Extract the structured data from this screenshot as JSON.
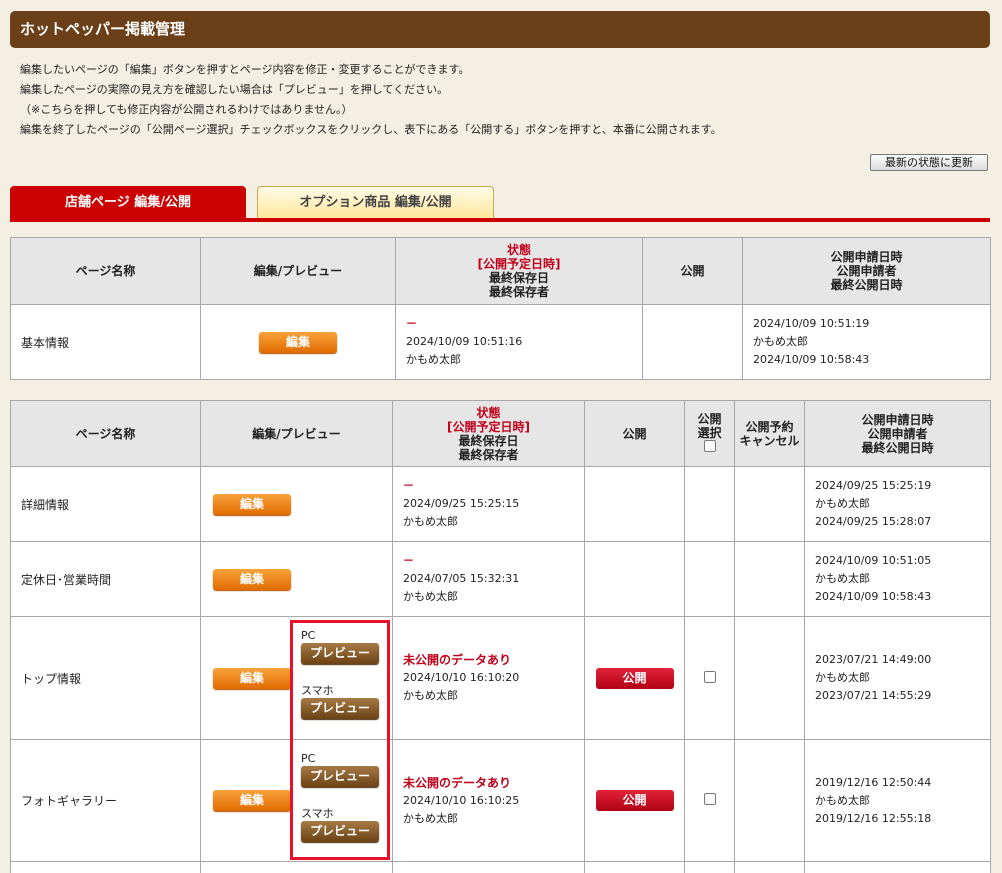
{
  "header": {
    "title": "ホットペッパー掲載管理"
  },
  "intro": {
    "lines": [
      "編集したいページの「編集」ボタンを押すとページ内容を修正・変更することができます。",
      "編集したページの実際の見え方を確認したい場合は「プレビュー」を押してください。",
      "（※こちらを押しても修正内容が公開されるわけではありません。）",
      "編集を終了したページの「公開ページ選択」チェックボックスをクリックし、表下にある「公開する」ボタンを押すと、本番に公開されます。"
    ]
  },
  "refresh_label": "最新の状態に更新",
  "tabs": [
    {
      "label": "店舗ページ 編集/公開",
      "active": true
    },
    {
      "label": "オプション商品 編集/公開",
      "active": false
    }
  ],
  "table1": {
    "headers": {
      "page_name": "ページ名称",
      "edit_preview": "編集/プレビュー",
      "status_top1": "状態",
      "status_top2": "[公開予定日時]",
      "status_bottom1": "最終保存日",
      "status_bottom2": "最終保存者",
      "publish": "公開",
      "dates1": "公開申請日時",
      "dates2": "公開申請者",
      "dates3": "最終公開日時"
    },
    "rows": [
      {
        "name": "基本情報",
        "edit": "編集",
        "status": "－",
        "saved": "2024/10/09 10:51:16",
        "saver": "かもめ太郎",
        "req_date": "2024/10/09 10:51:19",
        "requester": "かもめ太郎",
        "pub_date": "2024/10/09 10:58:43"
      }
    ]
  },
  "table2": {
    "headers": {
      "page_name": "ページ名称",
      "edit_preview": "編集/プレビュー",
      "status_top1": "状態",
      "status_top2": "[公開予定日時]",
      "status_bottom1": "最終保存日",
      "status_bottom2": "最終保存者",
      "publish": "公開",
      "select1": "公開",
      "select2": "選択",
      "cancel1": "公開予約",
      "cancel2": "キャンセル",
      "dates1": "公開申請日時",
      "dates2": "公開申請者",
      "dates3": "最終公開日時"
    },
    "rows": [
      {
        "name": "詳細情報",
        "edit": "編集",
        "status": "－",
        "saved": "2024/09/25 15:25:15",
        "saver": "かもめ太郎",
        "req_date": "2024/09/25 15:25:19",
        "requester": "かもめ太郎",
        "pub_date": "2024/09/25 15:28:07"
      },
      {
        "name": "定休日･営業時間",
        "edit": "編集",
        "status": "－",
        "saved": "2024/07/05 15:32:31",
        "saver": "かもめ太郎",
        "req_date": "2024/10/09 10:51:05",
        "requester": "かもめ太郎",
        "pub_date": "2024/10/09 10:58:43"
      },
      {
        "name": "トップ情報",
        "edit": "編集",
        "pc_label": "PC",
        "sp_label": "スマホ",
        "preview": "プレビュー",
        "status": "未公開のデータあり",
        "saved": "2024/10/10 16:10:20",
        "saver": "かもめ太郎",
        "publish": "公開",
        "req_date": "2023/07/21 14:49:00",
        "requester": "かもめ太郎",
        "pub_date": "2023/07/21 14:55:29"
      },
      {
        "name": "フォトギャラリー",
        "edit": "編集",
        "pc_label": "PC",
        "sp_label": "スマホ",
        "preview": "プレビュー",
        "status": "未公開のデータあり",
        "saved": "2024/10/10 16:10:25",
        "saver": "かもめ太郎",
        "publish": "公開",
        "req_date": "2019/12/16 12:50:44",
        "requester": "かもめ太郎",
        "pub_date": "2019/12/16 12:55:18"
      }
    ]
  },
  "colors": {
    "header_bg": "#6b3f17",
    "tab_active": "#cc0000",
    "edit_btn": "#e06b00",
    "preview_btn": "#6b4215",
    "publish_btn": "#b00013",
    "highlight": "#e8102a"
  }
}
